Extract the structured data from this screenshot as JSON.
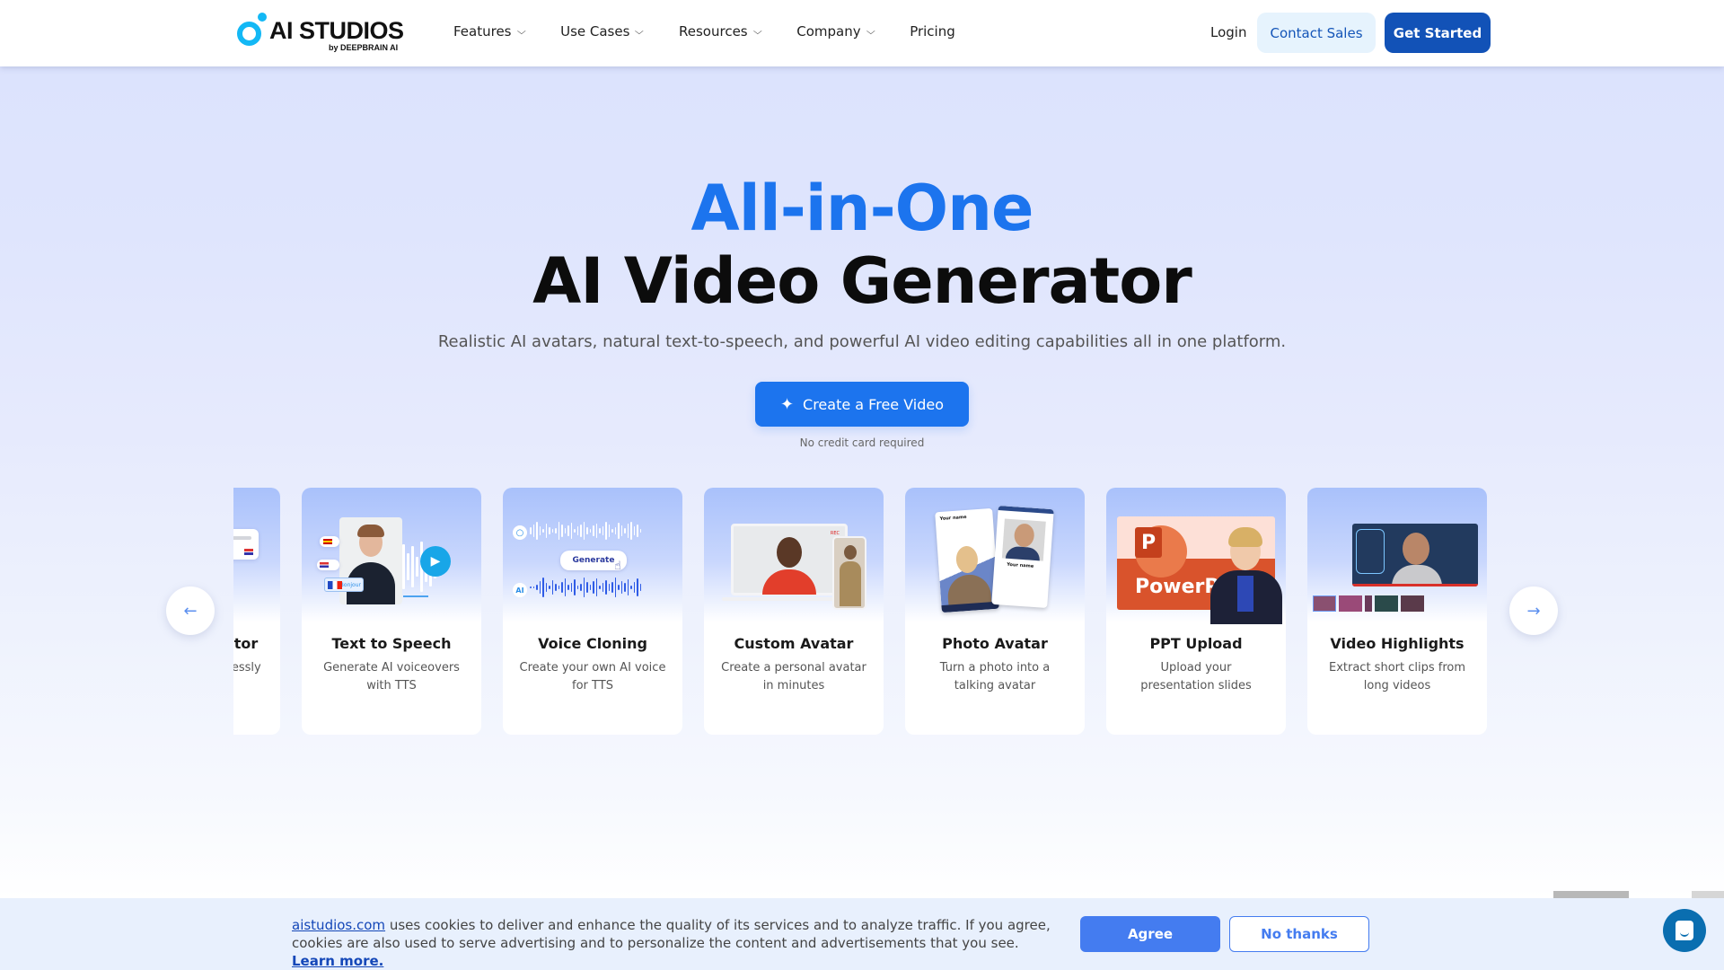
{
  "header": {
    "logo": {
      "name": "AI STUDIOS",
      "sub": "by DEEPBRAIN AI"
    },
    "nav": [
      {
        "label": "Features",
        "has_dropdown": true
      },
      {
        "label": "Use Cases",
        "has_dropdown": true
      },
      {
        "label": "Resources",
        "has_dropdown": true
      },
      {
        "label": "Company",
        "has_dropdown": true
      },
      {
        "label": "Pricing",
        "has_dropdown": false
      }
    ],
    "login_label": "Login",
    "contact_sales_label": "Contact Sales",
    "get_started_label": "Get Started"
  },
  "hero": {
    "title_line1": "All-in-One",
    "title_line2": "AI Video Generator",
    "subtitle": "Realistic AI avatars, natural text-to-speech, and powerful AI video editing capabilities all in one platform.",
    "cta_label": "Create a Free Video",
    "cta_icon": "sparkle-icon",
    "cta_note": "No credit card required"
  },
  "carousel": {
    "prev_icon": "arrow-left-icon",
    "next_icon": "arrow-right-icon",
    "cards": [
      {
        "title": "Script Generator",
        "desc": "Write scripts effortlessly with AI",
        "illustration_label": "Generate"
      },
      {
        "title": "Text to Speech",
        "desc": "Generate AI voiceovers with TTS",
        "illustration_label": "Bonjour"
      },
      {
        "title": "Voice Cloning",
        "desc": "Create your own AI voice for TTS",
        "illustration_label": "Generate",
        "ai_badge": "AI"
      },
      {
        "title": "Custom Avatar",
        "desc": "Create a personal avatar in minutes",
        "illustration_label": "REC"
      },
      {
        "title": "Photo Avatar",
        "desc": "Turn a photo into a talking avatar",
        "illustration_label": "Your name"
      },
      {
        "title": "PPT Upload",
        "desc": "Upload your presentation slides",
        "illustration_label": "PowerPoint",
        "ppt_letter": "P"
      },
      {
        "title": "Video Highlights",
        "desc": "Extract short clips from long videos",
        "illustration_label": ""
      }
    ]
  },
  "cookie_banner": {
    "site_link": "aistudios.com",
    "text": " uses cookies to deliver and enhance the quality of its services and to analyze traffic. If you agree, cookies are also used to serve advertising and to personalize the content and advertisements that you see. ",
    "learn_more": "Learn more.",
    "agree_label": "Agree",
    "no_thanks_label": "No thanks"
  },
  "chat_widget": {
    "icon": "chat-bubble-icon"
  },
  "colors": {
    "brand_blue": "#1c74ee",
    "navy_button": "#1252b7",
    "logo_cyan": "#13b8f5",
    "cookie_agree": "#447cf0",
    "chat_widget": "#0a6eb0"
  }
}
